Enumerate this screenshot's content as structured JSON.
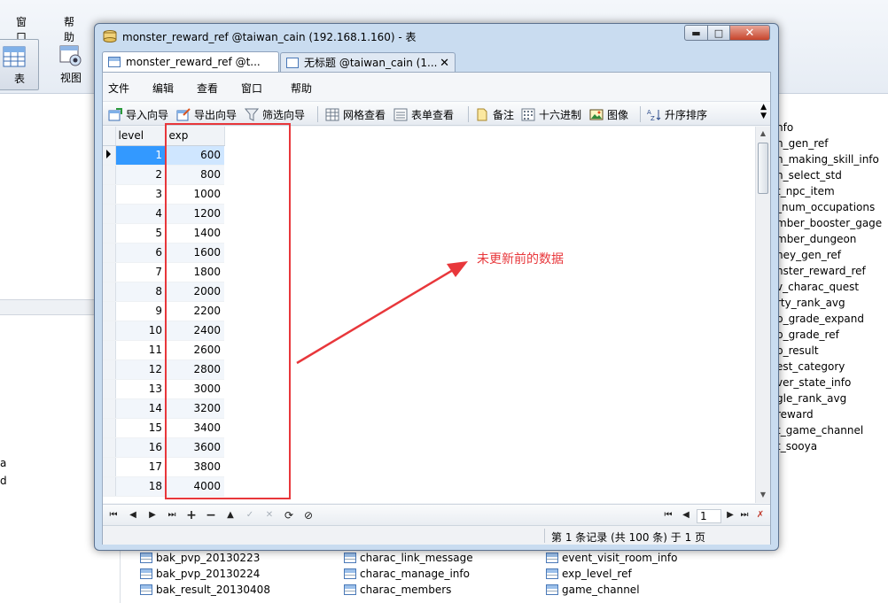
{
  "background_app": {
    "menu": [
      "窗口",
      "帮助"
    ],
    "toolbar": [
      {
        "label": "表",
        "icon": "table-icon",
        "active": true
      },
      {
        "label": "视图",
        "icon": "view-icon",
        "active": false
      }
    ],
    "left_fragments": [
      "a",
      "d"
    ],
    "right_table_list": [
      "nfo",
      "n_gen_ref",
      "n_making_skill_info",
      "n_select_std",
      "t_npc_item",
      "_num_occupations",
      "mber_booster_gage",
      "mber_dungeon",
      "ney_gen_ref",
      "nster_reward_ref",
      "v_charac_quest",
      "rty_rank_avg",
      "p_grade_expand",
      "p_grade_ref",
      "p_result",
      "est_category",
      "ver_state_info",
      "gle_rank_avg",
      "reward",
      "t_game_channel",
      "t_sooya"
    ],
    "bottom_tables": [
      [
        "bak_pvp_20130223",
        "charac_link_message",
        "event_visit_room_info"
      ],
      [
        "bak_pvp_20130224",
        "charac_manage_info",
        "exp_level_ref"
      ],
      [
        "bak_result_20130408",
        "charac_members",
        "game_channel"
      ]
    ]
  },
  "window": {
    "title": "monster_reward_ref @taiwan_cain (192.168.1.160) - 表",
    "tabs": [
      {
        "label": "monster_reward_ref @t...",
        "active": true
      },
      {
        "label": "无标题 @taiwan_cain (1...",
        "active": false
      }
    ],
    "menu": [
      "文件",
      "编辑",
      "查看",
      "窗口",
      "帮助"
    ],
    "toolbar": [
      {
        "label": "导入向导",
        "icon": "import-wizard-icon"
      },
      {
        "label": "导出向导",
        "icon": "export-wizard-icon"
      },
      {
        "label": "筛选向导",
        "icon": "filter-wizard-icon"
      },
      {
        "label": "网格查看",
        "icon": "grid-view-icon"
      },
      {
        "label": "表单查看",
        "icon": "form-view-icon"
      },
      {
        "label": "备注",
        "icon": "memo-icon"
      },
      {
        "label": "十六进制",
        "icon": "hex-icon"
      },
      {
        "label": "图像",
        "icon": "image-icon"
      },
      {
        "label": "升序排序",
        "icon": "sort-ascending-icon"
      }
    ],
    "grid": {
      "columns": [
        "level",
        "exp"
      ],
      "selected_row": 0,
      "rows": [
        [
          "1",
          "600"
        ],
        [
          "2",
          "800"
        ],
        [
          "3",
          "1000"
        ],
        [
          "4",
          "1200"
        ],
        [
          "5",
          "1400"
        ],
        [
          "6",
          "1600"
        ],
        [
          "7",
          "1800"
        ],
        [
          "8",
          "2000"
        ],
        [
          "9",
          "2200"
        ],
        [
          "10",
          "2400"
        ],
        [
          "11",
          "2600"
        ],
        [
          "12",
          "2800"
        ],
        [
          "13",
          "3000"
        ],
        [
          "14",
          "3200"
        ],
        [
          "15",
          "3400"
        ],
        [
          "16",
          "3600"
        ],
        [
          "17",
          "3800"
        ],
        [
          "18",
          "4000"
        ]
      ]
    },
    "navigation": {
      "buttons": [
        "first-record",
        "previous-record",
        "next-record",
        "last-record",
        "add-record",
        "delete-record",
        "move-up",
        "apply-changes",
        "discard-changes",
        "refresh",
        "stop"
      ],
      "page_value": "1"
    },
    "status": "第 1 条记录 (共 100 条) 于 1 页"
  },
  "annotation": {
    "text": "未更新前的数据",
    "color": "#e8373b"
  }
}
